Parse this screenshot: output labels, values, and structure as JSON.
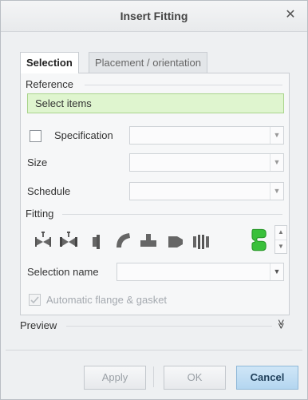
{
  "window": {
    "title": "Insert Fitting",
    "close_glyph": "✕"
  },
  "tabs": [
    {
      "label": "Selection",
      "active": true
    },
    {
      "label": "Placement / orientation",
      "active": false
    }
  ],
  "reference": {
    "group_label": "Reference",
    "value": "Select items"
  },
  "specification": {
    "label": "Specification",
    "checked": false,
    "value": ""
  },
  "size": {
    "label": "Size",
    "value": ""
  },
  "schedule": {
    "label": "Schedule",
    "value": ""
  },
  "fitting": {
    "group_label": "Fitting",
    "icons": [
      "valve-icon",
      "valve-flanged-icon",
      "flange-icon",
      "elbow-icon",
      "tee-icon",
      "reducer-icon",
      "union-icon",
      "custom-fitting-icon"
    ]
  },
  "selection_name": {
    "label": "Selection name",
    "value": ""
  },
  "auto_flange": {
    "label": "Automatic flange & gasket",
    "checked": true
  },
  "preview": {
    "label": "Preview",
    "expand_glyph": "≫"
  },
  "buttons": {
    "apply": "Apply",
    "ok": "OK",
    "cancel": "Cancel"
  },
  "colors": {
    "selection_highlight": "#dff5cf",
    "primary_button": "#b4d6f0",
    "accent_fitting": "#39c03a"
  }
}
